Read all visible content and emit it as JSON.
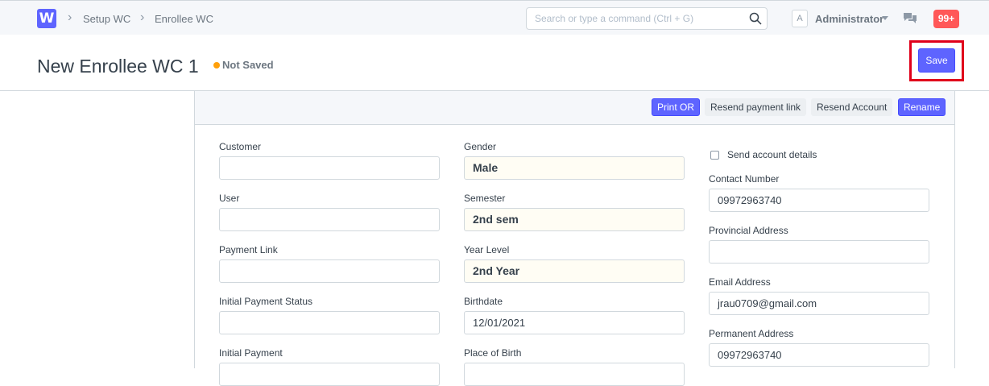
{
  "navbar": {
    "logo": "W",
    "breadcrumbs": [
      "Setup WC",
      "Enrollee WC"
    ],
    "search_placeholder": "Search or type a command (Ctrl + G)",
    "avatar_letter": "A",
    "user_name": "Administrator",
    "notification_count": "99+"
  },
  "page": {
    "title": "New Enrollee WC 1",
    "status": "Not Saved",
    "save_label": "Save"
  },
  "toolbar": {
    "print_or": "Print OR",
    "resend_payment_link": "Resend payment link",
    "resend_account": "Resend Account",
    "rename": "Rename"
  },
  "form": {
    "col1": [
      {
        "label": "Customer",
        "value": ""
      },
      {
        "label": "User",
        "value": ""
      },
      {
        "label": "Payment Link",
        "value": ""
      },
      {
        "label": "Initial Payment Status",
        "value": ""
      },
      {
        "label": "Initial Payment",
        "value": ""
      }
    ],
    "col2": [
      {
        "label": "Gender",
        "value": "Male"
      },
      {
        "label": "Semester",
        "value": "2nd sem"
      },
      {
        "label": "Year Level",
        "value": "2nd Year"
      },
      {
        "label": "Birthdate",
        "value": "12/01/2021"
      },
      {
        "label": "Place of Birth",
        "value": ""
      }
    ],
    "col3": {
      "send_account_label": "Send account details",
      "fields": [
        {
          "label": "Contact Number",
          "value": "09972963740"
        },
        {
          "label": "Provincial Address",
          "value": ""
        },
        {
          "label": "Email Address",
          "value": "jrau0709@gmail.com"
        },
        {
          "label": "Permanent Address",
          "value": "09972963740"
        }
      ]
    }
  },
  "colors": {
    "primary": "#5e64ff",
    "notification": "#ff5858",
    "unsaved_dot": "#ffa00a",
    "highlight": "#e0001b"
  }
}
